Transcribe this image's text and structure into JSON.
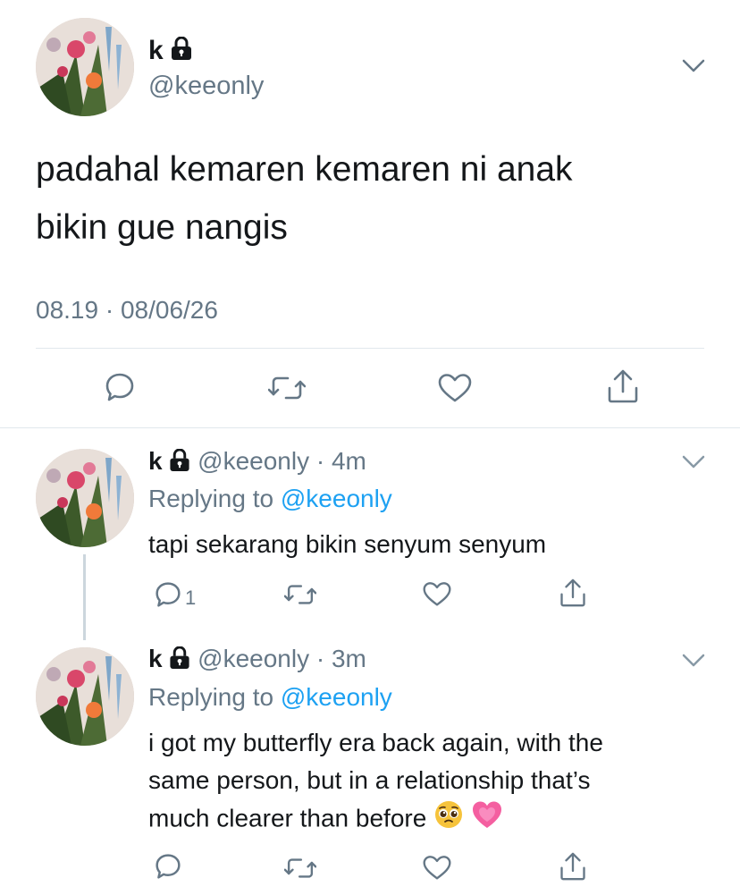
{
  "main_tweet": {
    "name": "k",
    "handle": "@keeonly",
    "text_line1": "padahal kemaren kemaren ni anak",
    "text_line2": "bikin gue nangis",
    "timestamp": "08.19 · 08/06/26"
  },
  "replies": [
    {
      "name": "k",
      "handle_time": "@keeonly · 4m",
      "replying_prefix": "Replying to ",
      "replying_handle": "@keeonly",
      "text": "tapi sekarang bikin senyum senyum",
      "reply_count": "1"
    },
    {
      "name": "k",
      "handle_time": "@keeonly · 3m",
      "replying_prefix": "Replying to ",
      "replying_handle": "@keeonly",
      "text_line1": "i got my butterfly era back again, with the",
      "text_line2": "same person, but in a relationship that’s",
      "text_line3": "much clearer than before",
      "emojis": [
        "pleading-face",
        "growing-heart"
      ]
    }
  ],
  "icons": {
    "reply": "speech-bubble-icon",
    "retweet": "retweet-icon",
    "like": "heart-icon",
    "share": "share-icon",
    "more": "chevron-down-icon",
    "protected": "lock-icon"
  },
  "colors": {
    "text": "#14171a",
    "secondary": "#657786",
    "link": "#1da1f2",
    "divider": "#e1e8ed"
  }
}
